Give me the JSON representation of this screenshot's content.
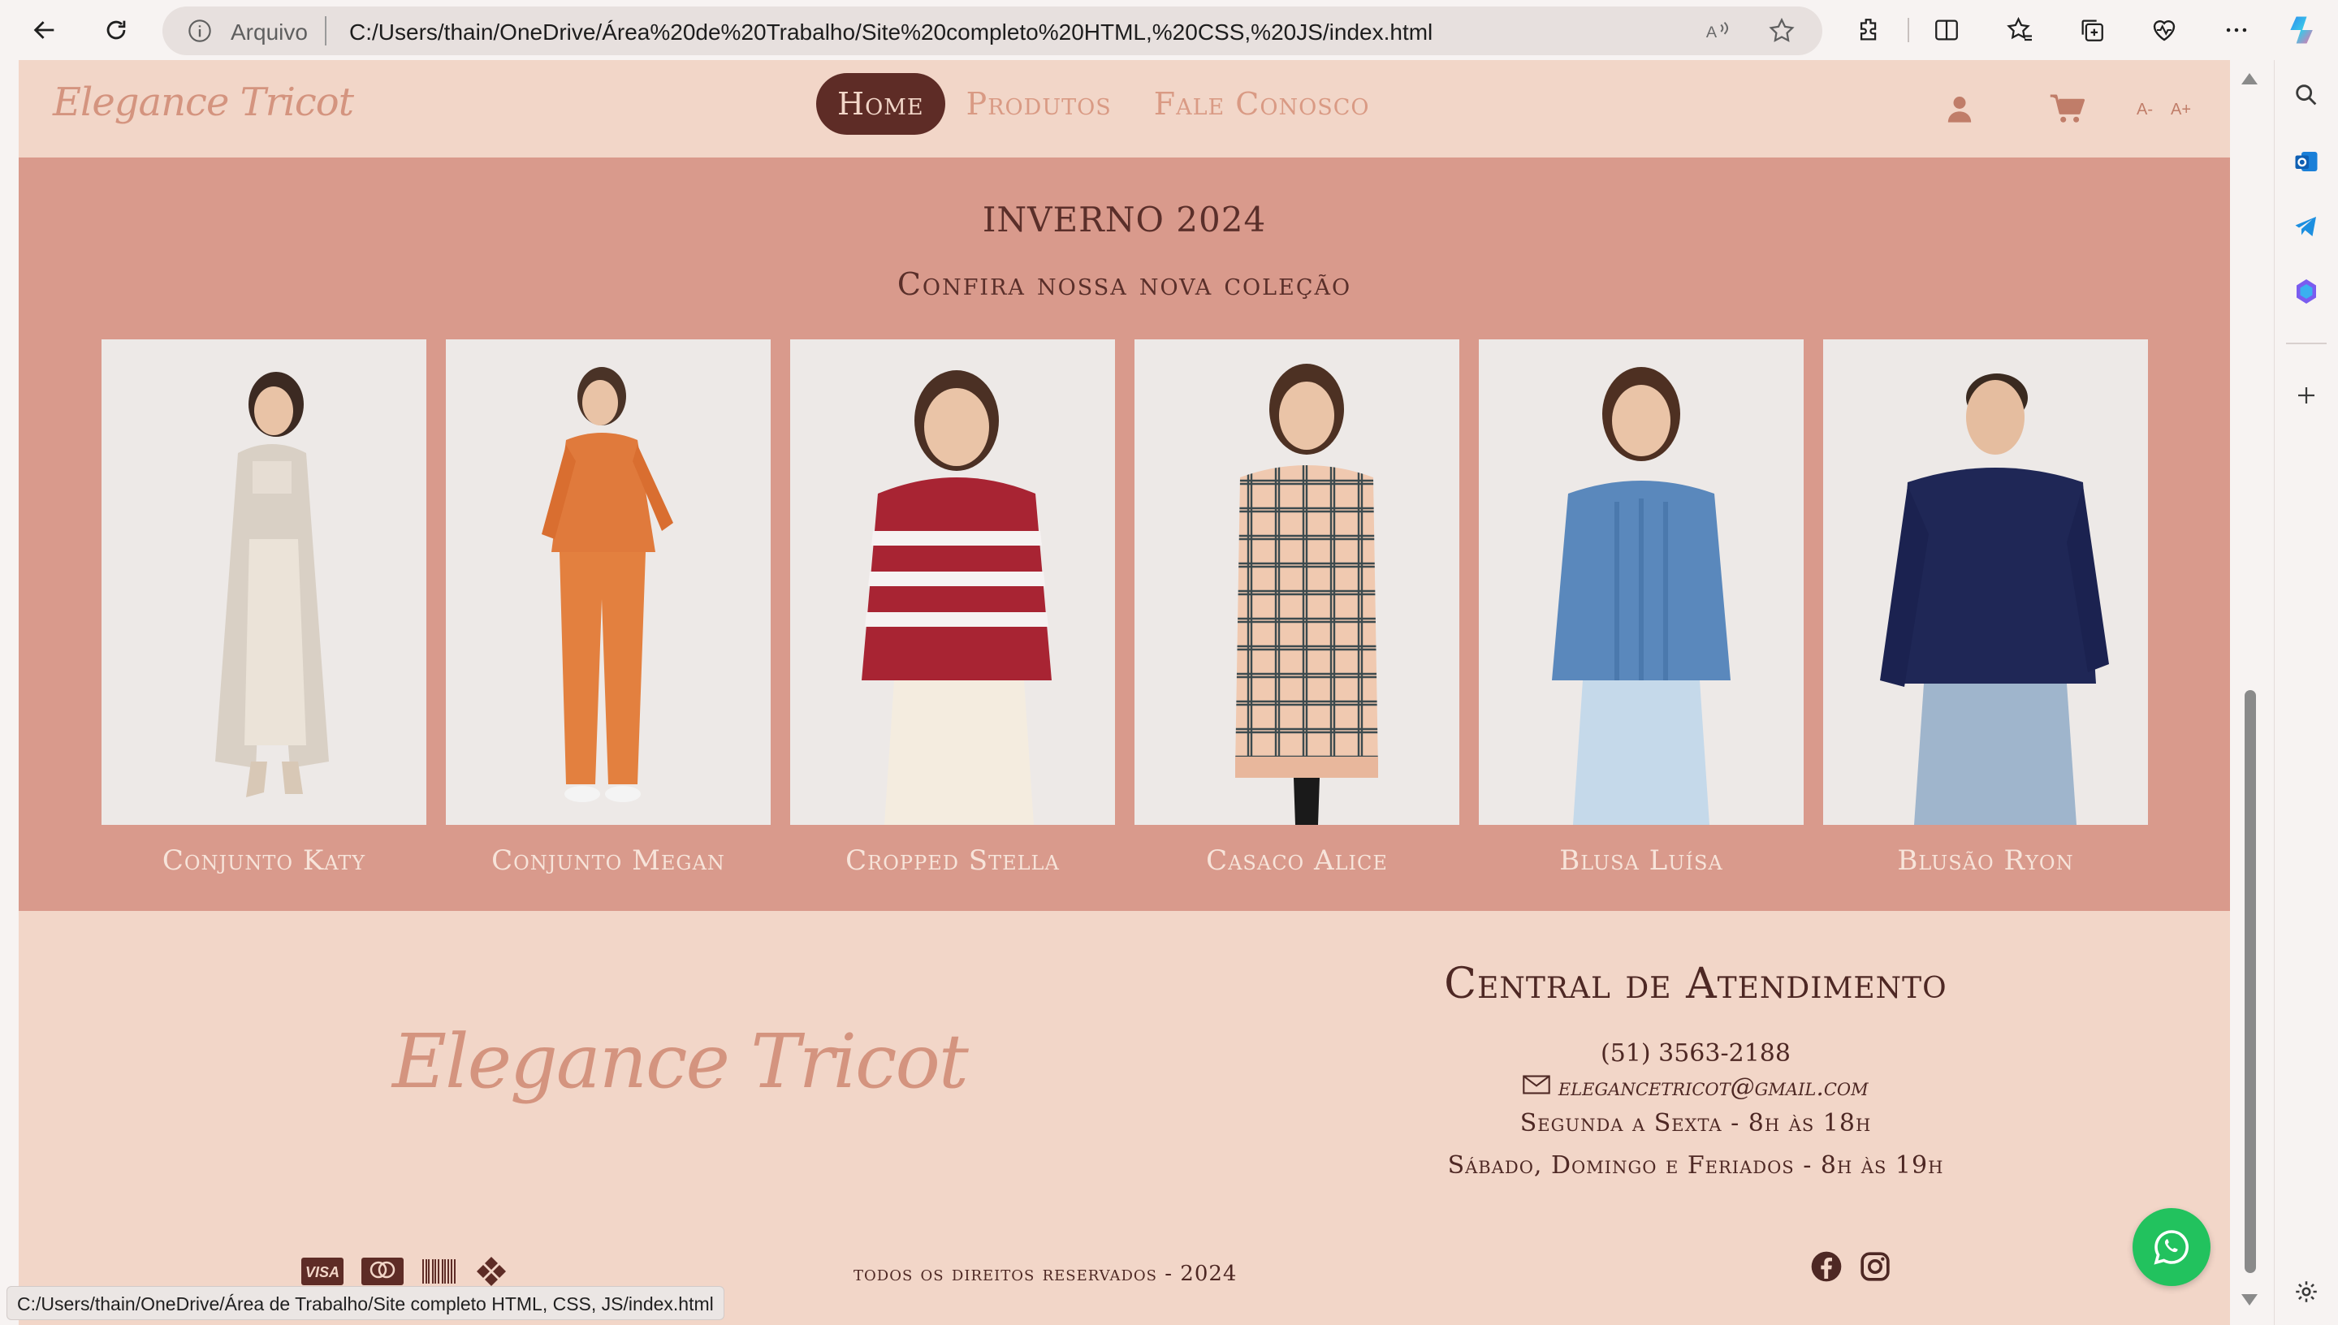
{
  "browser": {
    "address_prefix": "Arquivo",
    "url": "C:/Users/thain/OneDrive/Área%20de%20Trabalho/Site%20completo%20HTML,%20CSS,%20JS/index.html",
    "status_url": "C:/Users/thain/OneDrive/Área de Trabalho/Site completo HTML, CSS, JS/index.html",
    "toolbar_icons": [
      "back-icon",
      "refresh-icon",
      "read-aloud-icon",
      "favorite-star-icon",
      "extensions-icon",
      "split-screen-icon",
      "favorites-icon",
      "collections-icon",
      "browser-essentials-icon",
      "more-icon",
      "copilot-icon"
    ],
    "sidebar_icons": [
      "search-icon",
      "outlook-icon",
      "telegram-icon",
      "office-icon",
      "add-icon",
      "settings-icon"
    ]
  },
  "site": {
    "logo": "Elegance Tricot",
    "nav": [
      {
        "label": "Home",
        "active": true
      },
      {
        "label": "Produtos",
        "active": false
      },
      {
        "label": "Fale Conosco",
        "active": false
      }
    ],
    "header_icons": [
      "user-icon",
      "cart-icon"
    ],
    "font_decrease": "A-",
    "font_increase": "A+"
  },
  "collection": {
    "title": "INVERNO 2024",
    "subtitle": "Confira nossa nova coleção",
    "products": [
      {
        "name": "Conjunto Katy",
        "outfit": "beige long cardigan set",
        "color": "#d9d0c5"
      },
      {
        "name": "Conjunto Megan",
        "outfit": "orange knit set",
        "color": "#e07a3c"
      },
      {
        "name": "Cropped Stella",
        "outfit": "red striped sweater",
        "color": "#a82433"
      },
      {
        "name": "Casaco Alice",
        "outfit": "plaid long cardigan",
        "color": "#e8c4a8"
      },
      {
        "name": "Blusa Luísa",
        "outfit": "blue cable knit sweater",
        "color": "#5a88bc"
      },
      {
        "name": "Blusão Ryon",
        "outfit": "navy sweater",
        "color": "#1f2756"
      }
    ]
  },
  "footer": {
    "logo": "Elegance Tricot",
    "title": "Central de Atendimento",
    "phone": "(51) 3563-2188",
    "email": "elegancetricot@gmail.com",
    "hours_week": "Segunda a Sexta - 8h às 18h",
    "hours_weekend": "Sábado, Domingo e Feriados - 8h às 19h",
    "rights": "todos os direitos reservados - 2024",
    "payment_icons": [
      "visa-icon",
      "mastercard-icon",
      "barcode-boleto-icon",
      "pix-icon"
    ],
    "visa_text": "VISA",
    "social_icons": [
      "facebook-icon",
      "instagram-icon"
    ]
  },
  "colors": {
    "header_bg": "#f2d6c8",
    "collection_bg": "#d99a8c",
    "nav_active_bg": "#5e2c26",
    "accent": "#d4947f",
    "whatsapp": "#22c25e"
  }
}
